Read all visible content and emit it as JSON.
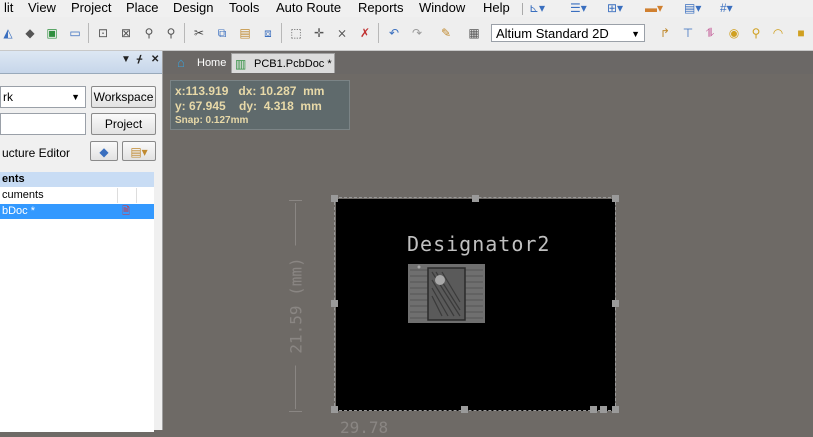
{
  "menubar": {
    "items": [
      "lit",
      "View",
      "Project",
      "Place",
      "Design",
      "Tools",
      "Auto Route",
      "Reports",
      "Window",
      "Help"
    ]
  },
  "toolbar": {
    "view_select_value": "Altium Standard 2D",
    "icons": [
      "layers-icon",
      "board-icon",
      "save-icon",
      "zoom-icon",
      "zoom-fit-icon",
      "zoom-select-icon",
      "cut-icon",
      "copy-icon",
      "paste-icon",
      "rubber-stamp-icon",
      "select-rect-icon",
      "move-icon",
      "deselect-icon",
      "cross-icon",
      "undo-icon",
      "redo-icon",
      "pen-icon",
      "library-icon",
      "route-icon",
      "interactive-route-icon",
      "diff-pair-icon",
      "via-icon",
      "pad-icon",
      "arc-icon",
      "fill-icon"
    ]
  },
  "panel": {
    "header_pin": "▼ ╨ ×",
    "project_combo": "rk",
    "workspace_btn": "Workspace",
    "project_btn": "Project",
    "structure_label": "ucture Editor",
    "tree_header": "ents",
    "tree_rows": [
      "cuments",
      "bDoc *"
    ]
  },
  "tabs": [
    {
      "label": "Home"
    },
    {
      "label": "PCB1.PcbDoc *"
    }
  ],
  "hud": {
    "line1": "x:113.919   dx: 10.287  mm",
    "line2": "y: 67.945    dy:  4.318  mm",
    "line3": "Snap: 0.127mm"
  },
  "canvas": {
    "designator": "Designator2",
    "dimension_vertical": "21.59 (mm)",
    "dimension_horizontal": "29.78"
  },
  "colors": {
    "workspace": "#6e6a66",
    "board": "#000000",
    "selected_row": "#3399ff",
    "tree_header": "#c8dcf4"
  }
}
